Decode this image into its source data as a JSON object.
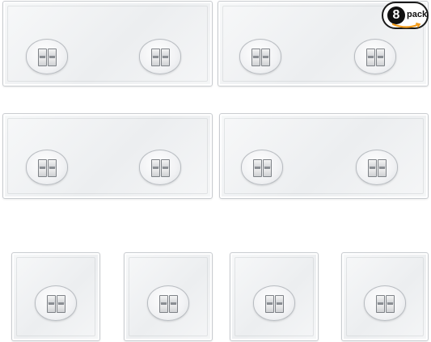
{
  "badge": {
    "count": "8",
    "label": "pack",
    "smile_color": "#f29b1a"
  },
  "product": {
    "pads": [
      {
        "kind": "rectangular",
        "hooks": 2
      },
      {
        "kind": "rectangular",
        "hooks": 2
      },
      {
        "kind": "rectangular",
        "hooks": 2
      },
      {
        "kind": "rectangular",
        "hooks": 2
      },
      {
        "kind": "square",
        "hooks": 1
      },
      {
        "kind": "square",
        "hooks": 1
      },
      {
        "kind": "square",
        "hooks": 1
      },
      {
        "kind": "square",
        "hooks": 1
      }
    ],
    "pad_color": "#eef0f2",
    "hook_icon": "adhesive-hook-icon"
  }
}
